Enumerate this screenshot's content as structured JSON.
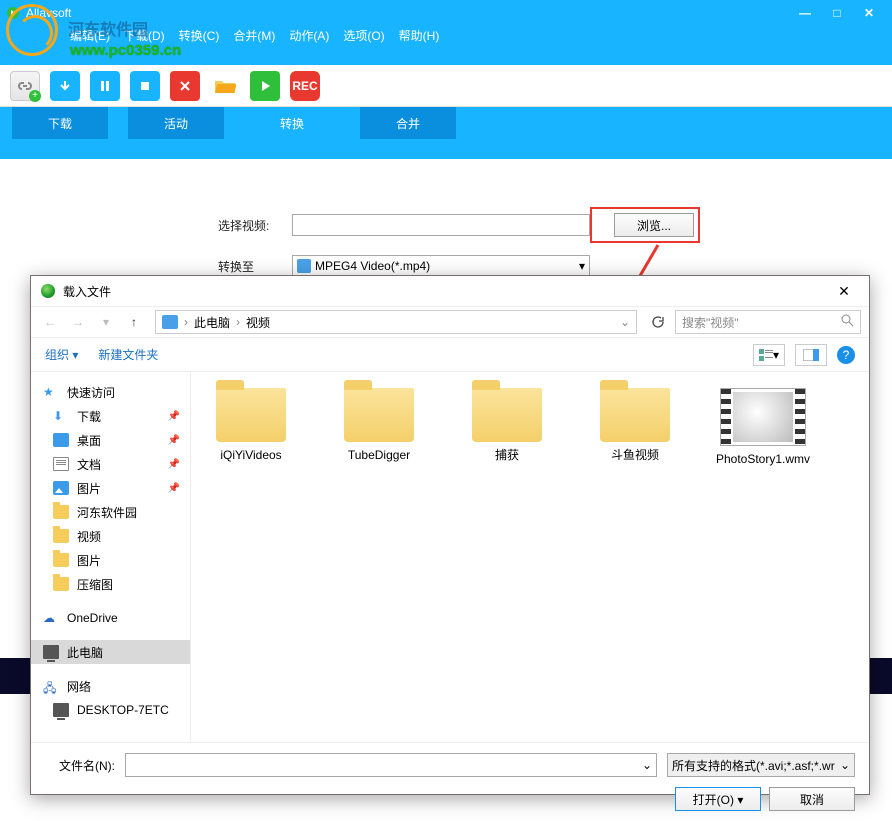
{
  "titlebar": {
    "title": "Allavsoft"
  },
  "watermark": {
    "line1": "河东软件园",
    "line2": "www.pc0359.cn"
  },
  "menu": {
    "edit": "编辑(E)",
    "download": "下载(D)",
    "convert": "转换(C)",
    "merge": "合并(M)",
    "action": "动作(A)",
    "options": "选项(O)",
    "help": "帮助(H)"
  },
  "toolbar": {
    "rec": "REC"
  },
  "tabs": {
    "download": "下载",
    "activity": "活动",
    "convert": "转换",
    "merge": "合并"
  },
  "form": {
    "select_video": "选择视频:",
    "convert_to": "转换至",
    "browse": "浏览...",
    "format_value": "MPEG4 Video(*.mp4)"
  },
  "dialog": {
    "title": "载入文件",
    "bc1": "此电脑",
    "bc2": "视频",
    "search_placeholder": "搜索\"视频\"",
    "organize": "组织",
    "new_folder": "新建文件夹",
    "sidebar": {
      "quick": "快速访问",
      "downloads": "下载",
      "desktop": "桌面",
      "documents": "文档",
      "pictures": "图片",
      "hedong": "河东软件园",
      "videos": "视频",
      "pictures2": "图片",
      "thumbs": "压缩图",
      "onedrive": "OneDrive",
      "thispc": "此电脑",
      "network": "网络",
      "desk7etc": "DESKTOP-7ETC"
    },
    "files": {
      "f1": "iQiYiVideos",
      "f2": "TubeDigger",
      "f3": "捕获",
      "f4": "斗鱼视频",
      "f5": "PhotoStory1.wmv"
    },
    "filename_label": "文件名(N):",
    "filetype": "所有支持的格式(*.avi;*.asf;*.wr",
    "open": "打开(O)",
    "cancel": "取消"
  }
}
